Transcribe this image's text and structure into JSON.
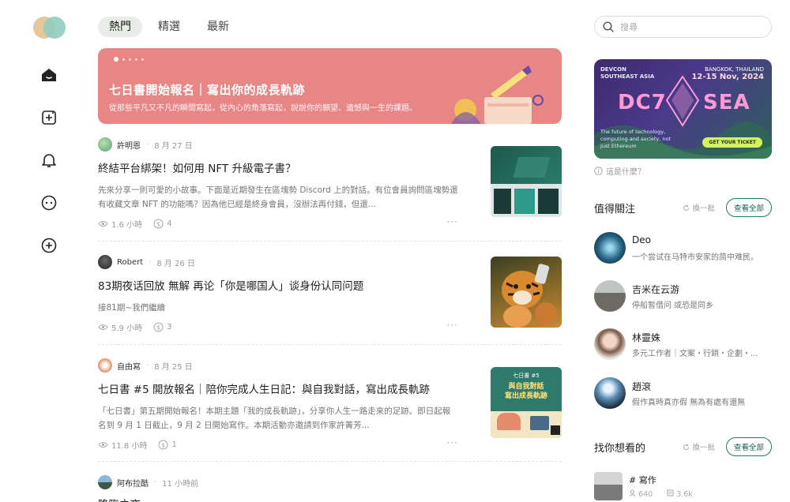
{
  "tabs": [
    "熱門",
    "精選",
    "最新"
  ],
  "banner": {
    "title": "七日書開始報名｜寫出你的成長軌跡",
    "subtitle": "從那些平凡又不凡的瞬間寫起，從內心的角落寫起，說說你的願望、遺憾與一生的課題。"
  },
  "posts": [
    {
      "author": "許明恩",
      "date": "8 月 27 日",
      "title": "終結平台綁架！如何用 NFT 升級電子書？",
      "excerpt": "先來分享一則可愛的小故事。下面是近期發生在區塊勢 Discord 上的對話。有位會員詢問區塊勢還有收藏文章 NFT 的功能嗎？因為他已經是終身會員，沒辦法再付錢，但還...",
      "views": "1.6 小時",
      "tips": "4"
    },
    {
      "author": "Robert",
      "date": "8 月 26 日",
      "title": "83期夜话回放 無解 再论「你是哪国人」谈身份认同问题",
      "excerpt": "接81期~我們繼續",
      "views": "5.9 小時",
      "tips": "3"
    },
    {
      "author": "自由寫",
      "date": "8 月 25 日",
      "title": "七日書 #5 開放報名｜陪你完成人生日記：與自我對話，寫出成長軌跡",
      "excerpt": "「七日書」第五期開始報名！本期主題「我的成長軌跡」，分享你人生一路走來的足跡。即日起報名到 9 月 1 日截止，9 月 2 日開始寫作。本期活動亦邀請到作家許菁芳...",
      "views": "11.8 小時",
      "tips": "1"
    },
    {
      "author": "阿布拉酷",
      "date": "11 小時前",
      "title": "降臨之夜"
    }
  ],
  "thumb3": {
    "line1": "七日書 #5",
    "line2": "與自我對話",
    "line3": "寫出成長軌跡"
  },
  "search": {
    "placeholder": "搜尋"
  },
  "ad": {
    "event": "DEVCON",
    "region": "SOUTHEAST ASIA",
    "location": "BANGKOK, THAILAND",
    "dates": "12-15 Nov, 2024",
    "brand_left": "DC7",
    "brand_right": "SEA",
    "description": "The future of technology, computing and society, not just Ethereum",
    "cta": "GET YOUR TICKET"
  },
  "what_is": "這是什麼？",
  "follow": {
    "title": "值得關注",
    "refresh": "換一批",
    "view_all": "查看全部",
    "users": [
      {
        "name": "Deo",
        "bio": "一个尝试在马特市安家的简中难民。"
      },
      {
        "name": "吉米在云游",
        "bio": "停船暂借问 或恐是同乡"
      },
      {
        "name": "林靈姝",
        "bio": "多元工作者｜文案・行銷・企劃・..."
      },
      {
        "name": "趙滾",
        "bio": "假作真時真亦假 無為有處有還無"
      }
    ]
  },
  "discover": {
    "title": "找你想看的",
    "refresh": "換一批",
    "view_all": "查看全部",
    "topic": {
      "name": "# 寫作",
      "followers": "640",
      "articles": "3.6k"
    }
  },
  "colors": {
    "brand": "#136152",
    "banner": "#e88585"
  }
}
